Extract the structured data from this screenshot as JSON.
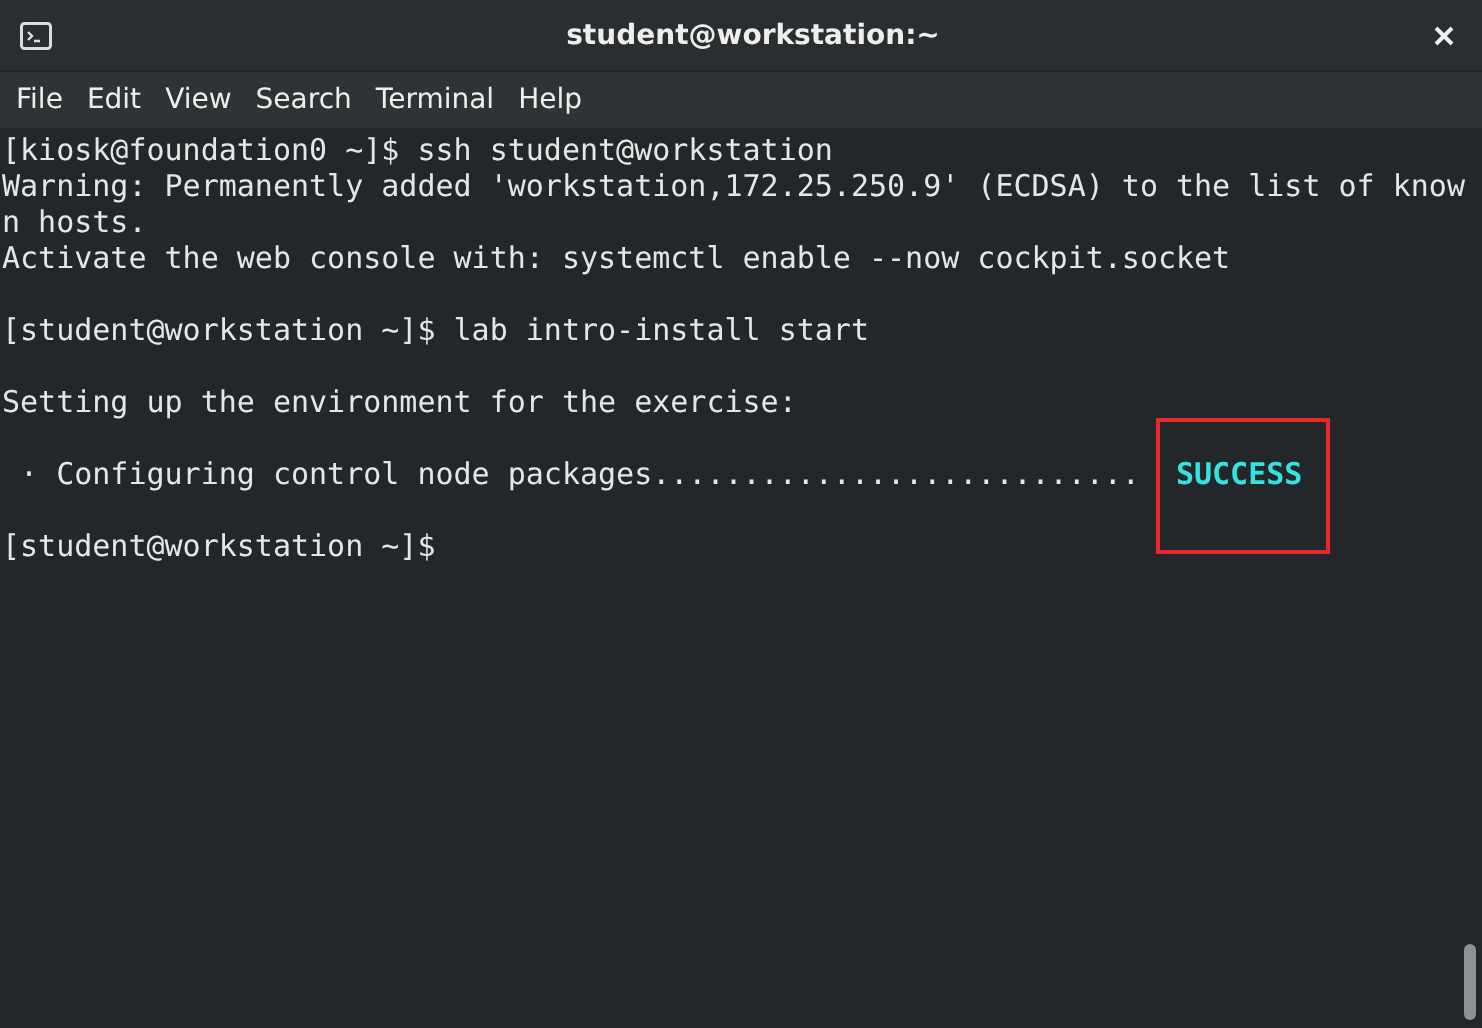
{
  "window": {
    "title": "student@workstation:~"
  },
  "menu": [
    "File",
    "Edit",
    "View",
    "Search",
    "Terminal",
    "Help"
  ],
  "lines": [
    {
      "kind": "text",
      "text": "[kiosk@foundation0 ~]$ ssh student@workstation"
    },
    {
      "kind": "text",
      "text": "Warning: Permanently added 'workstation,172.25.250.9' (ECDSA) to the list of know"
    },
    {
      "kind": "text",
      "text": "n hosts."
    },
    {
      "kind": "text",
      "text": "Activate the web console with: systemctl enable --now cockpit.socket"
    },
    {
      "kind": "blank"
    },
    {
      "kind": "text",
      "text": "[student@workstation ~]$ lab intro-install start"
    },
    {
      "kind": "blank"
    },
    {
      "kind": "text",
      "text": "Setting up the environment for the exercise:"
    },
    {
      "kind": "blank"
    },
    {
      "kind": "status",
      "text": " · Configuring control node packages...........................",
      "status": "SUCCESS",
      "color": "#34e2e2",
      "highlighted": true
    },
    {
      "kind": "blank"
    },
    {
      "kind": "text",
      "text": "[student@workstation ~]$"
    }
  ]
}
